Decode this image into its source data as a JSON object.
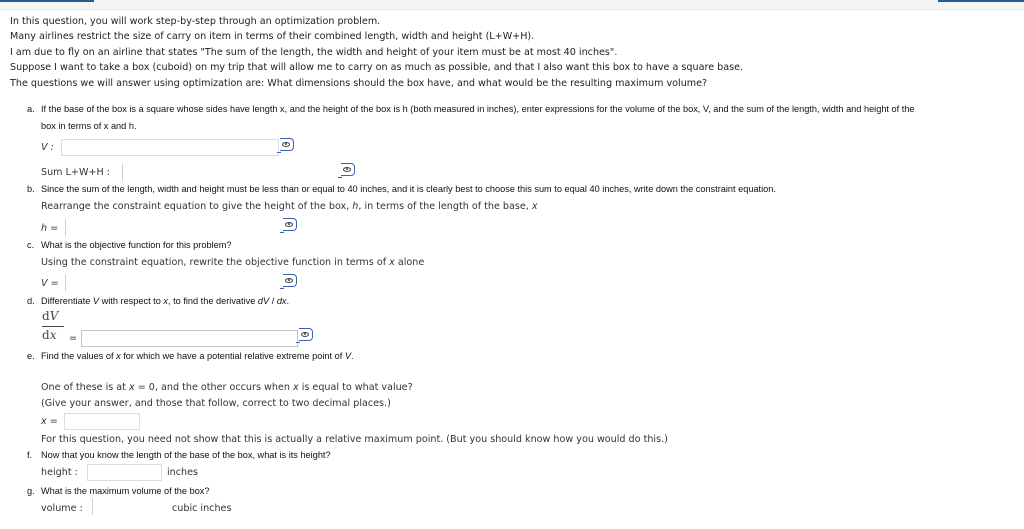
{
  "intro": [
    "In this question, you will work step-by-step through an optimization problem.",
    "Many airlines restrict the size of carry on item in terms of their combined length, width and height (L+W+H).",
    "I am due to fly on an airline that states \"The sum of the length, the width and height of your item must be at most 40 inches\".",
    "Suppose I want to take a box (cuboid) on my trip that will allow me to carry on as much as possible, and that I also want this box to have a square base.",
    "The questions we will answer using optimization are: What dimensions should the box have, and what would be the resulting maximum volume?"
  ],
  "parts": {
    "a": {
      "letter": "a.",
      "text_line1": "If the base of the box is a square whose sides have length x, and the height of the box is h (both measured in inches), enter expressions for the volume of the box, V, and the sum of the length, width and height of the",
      "text_line2": "box in terms of x and h.",
      "volume_label": "V :",
      "volume_value": "",
      "sum_label": "Sum L+W+H :",
      "sum_value": ""
    },
    "b": {
      "letter": "b.",
      "text": "Since the sum of the length, width and height must be less than or equal to 40 inches, and it is clearly best to choose this sum to equal 40 inches, write down the constraint equation.",
      "subtext": "Rearrange the constraint equation to give the height of the box, h, in terms of the length of the base, x",
      "h_label": "h =",
      "h_value": ""
    },
    "c": {
      "letter": "c.",
      "text": "What is the objective function for this problem?",
      "subtext": "Using the constraint equation, rewrite the objective function in terms of x alone",
      "v_label": "V =",
      "v_value": ""
    },
    "d": {
      "letter": "d.",
      "text": "Differentiate V with respect to x, to find the derivative dV / dx.",
      "frac_num": "dV",
      "frac_den": "dx",
      "eq": "=",
      "dvdx_value": ""
    },
    "e": {
      "letter": "e.",
      "text": "Find the values of x for which we have a potential relative extreme point of V.",
      "line1": "One of these is at x = 0, and the other occurs when x is equal to what value?",
      "line2": "(Give your answer, and those that follow, correct to two decimal places.)",
      "x_label": "x =",
      "x_value": "",
      "note": "For this question, you need not show that this is actually a relative maximum point. (But you should know how you would do this.)"
    },
    "f": {
      "letter": "f.",
      "text": "Now that you know the length of the base of the box, what is its height?",
      "height_label": "height :",
      "height_value": "",
      "height_unit": "inches"
    },
    "g": {
      "letter": "g.",
      "text": "What is the maximum volume of the box?",
      "volume_label": "volume :",
      "volume_value": "",
      "volume_unit": "cubic inches"
    }
  },
  "icons": {
    "preview": "eye-preview-icon"
  },
  "colors": {
    "accent": "#2a5d8f",
    "preview_icon": "#3a63b3"
  }
}
